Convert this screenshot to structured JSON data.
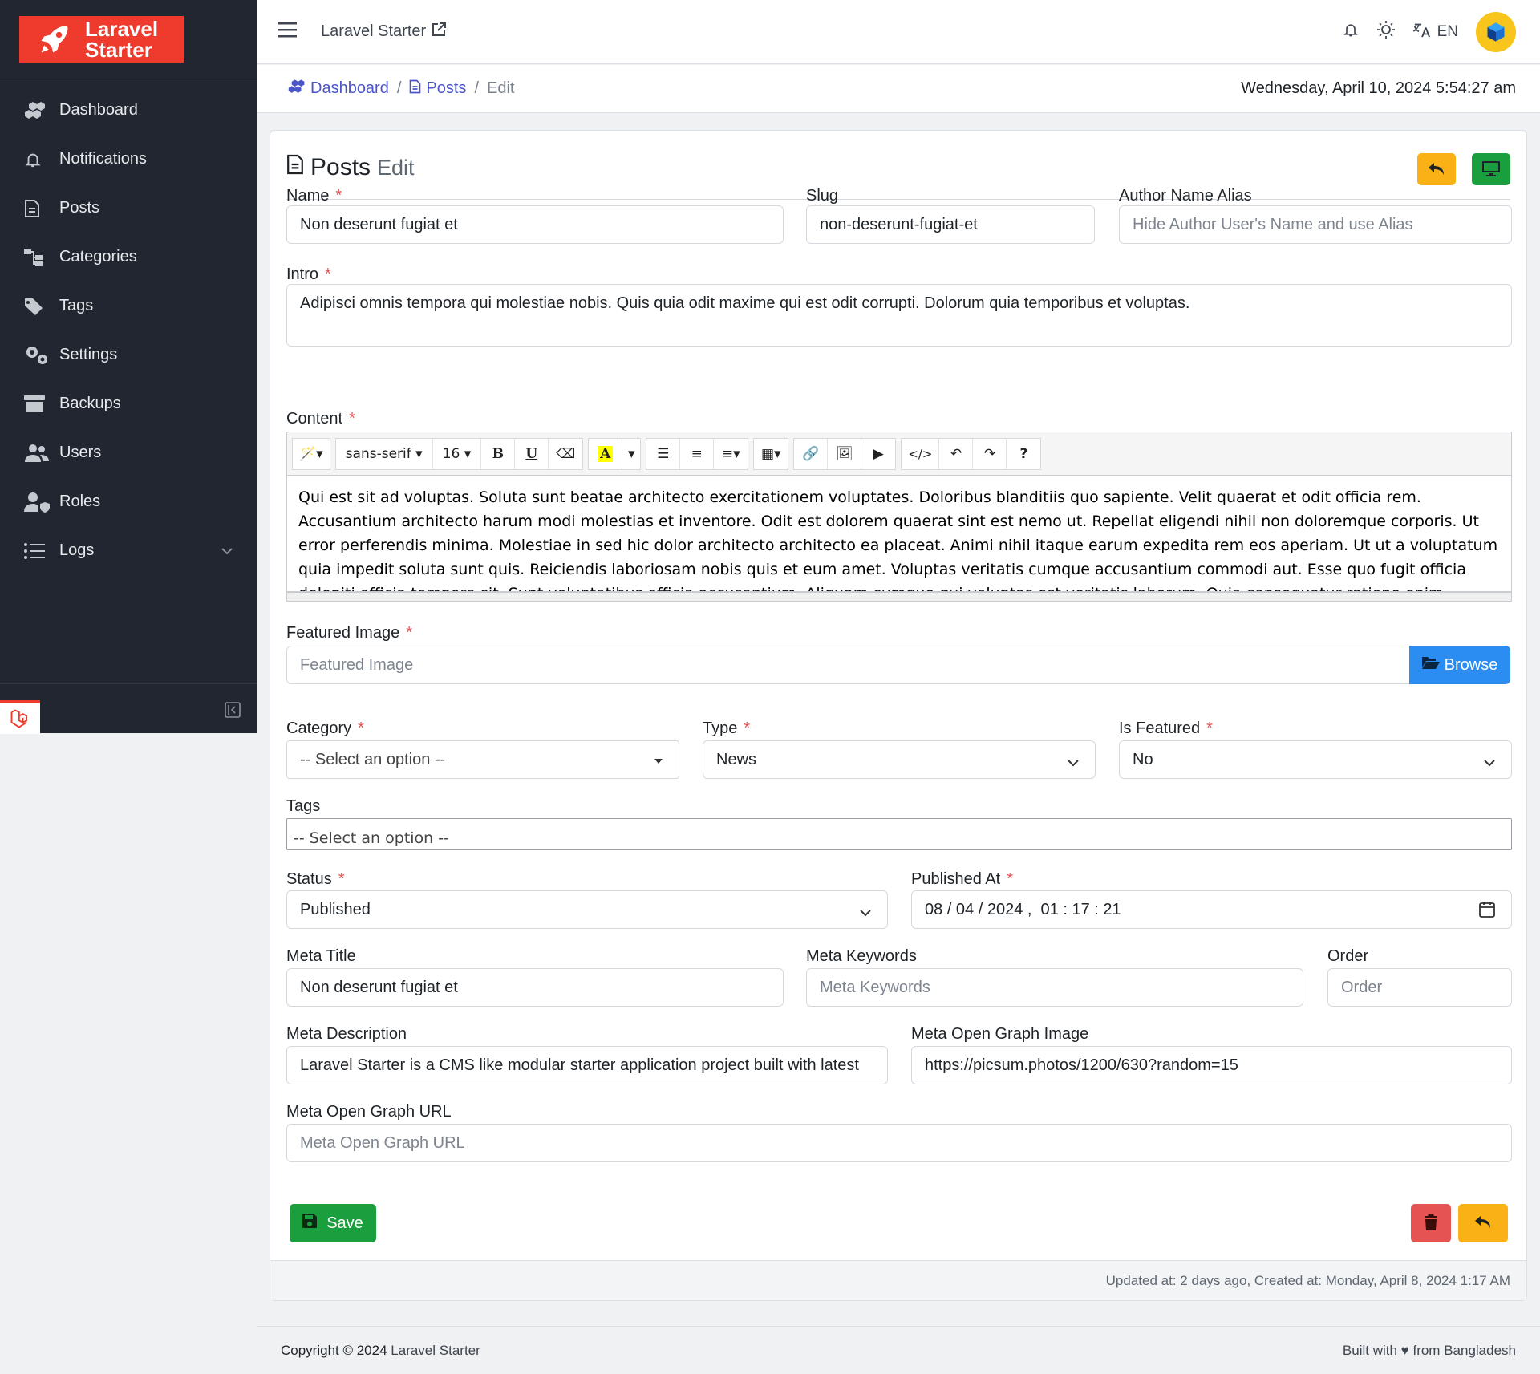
{
  "sidebar": {
    "logo_line1": "Laravel",
    "logo_line2": "Starter",
    "items": [
      {
        "label": "Dashboard"
      },
      {
        "label": "Notifications"
      },
      {
        "label": "Posts"
      },
      {
        "label": "Categories"
      },
      {
        "label": "Tags"
      },
      {
        "label": "Settings"
      },
      {
        "label": "Backups"
      },
      {
        "label": "Users"
      },
      {
        "label": "Roles"
      },
      {
        "label": "Logs"
      }
    ]
  },
  "header": {
    "app_title": "Laravel Starter",
    "language": "EN"
  },
  "breadcrumb": {
    "dashboard": "Dashboard",
    "posts": "Posts",
    "current": "Edit",
    "sep": "/"
  },
  "datetime": "Wednesday, April 10, 2024 5:54:27 am",
  "page": {
    "title": "Posts",
    "subtitle": "Edit"
  },
  "form": {
    "name": {
      "label": "Name",
      "value": "Non deserunt fugiat et"
    },
    "slug": {
      "label": "Slug",
      "value": "non-deserunt-fugiat-et"
    },
    "author_alias": {
      "label": "Author Name Alias",
      "placeholder": "Hide Author User's Name and use Alias"
    },
    "intro": {
      "label": "Intro",
      "value": "Adipisci omnis tempora qui molestiae nobis. Quis quia odit maxime qui est odit corrupti. Dolorum quia temporibus et voluptas."
    },
    "content": {
      "label": "Content",
      "font_name": "sans-serif",
      "font_size": "16",
      "value": "Qui est sit ad voluptas. Soluta sunt beatae architecto exercitationem voluptates. Doloribus blanditiis quo sapiente. Velit quaerat et odit officia rem. Accusantium architecto harum modi molestias et inventore. Odit est dolorem quaerat sint est nemo ut. Repellat eligendi nihil non doloremque corporis. Ut error perferendis minima. Molestiae in sed hic dolor architecto architecto ea placeat. Animi nihil itaque earum expedita rem eos aperiam. Ut ut a voluptatum quia impedit soluta sunt quis. Reiciendis laboriosam nobis quis et eum amet. Voluptas veritatis cumque accusantium commodi aut. Esse quo fugit officia deleniti officia tempora sit. Sunt voluptatibus officia accusantium. Aliquam cumque qui voluptas est veritatis laborum. Quia consequatur ratione enim excepturi in omnis facere."
    },
    "featured_image": {
      "label": "Featured Image",
      "placeholder": "Featured Image",
      "browse": "Browse"
    },
    "category": {
      "label": "Category",
      "value": "-- Select an option --"
    },
    "type": {
      "label": "Type",
      "value": "News"
    },
    "is_featured": {
      "label": "Is Featured",
      "value": "No"
    },
    "tags": {
      "label": "Tags",
      "value": "-- Select an option --"
    },
    "status": {
      "label": "Status",
      "value": "Published"
    },
    "published_at": {
      "label": "Published At",
      "value": "08 / 04 / 2024 ,  01 : 17 : 21"
    },
    "meta_title": {
      "label": "Meta Title",
      "value": "Non deserunt fugiat et"
    },
    "meta_keywords": {
      "label": "Meta Keywords",
      "placeholder": "Meta Keywords"
    },
    "order": {
      "label": "Order",
      "placeholder": "Order"
    },
    "meta_description": {
      "label": "Meta Description",
      "value": "Laravel Starter is a CMS like modular starter application project built with latest"
    },
    "meta_og_image": {
      "label": "Meta Open Graph Image",
      "value": "https://picsum.photos/1200/630?random=15"
    },
    "meta_og_url": {
      "label": "Meta Open Graph URL",
      "placeholder": "Meta Open Graph URL"
    },
    "required_mark": "*"
  },
  "buttons": {
    "save": "Save"
  },
  "card_footer": "Updated at: 2 days ago, Created at: Monday, April 8, 2024 1:17 AM",
  "footer": {
    "copyright": "Copyright © 2024",
    "brand": "Laravel Starter",
    "built": "Built with ♥ from Bangladesh"
  },
  "colors": {
    "sidebar_bg": "#212631",
    "brand_red": "#ef3b2d",
    "link": "#4a55c7",
    "warning": "#f9b115",
    "success": "#1b9e3e",
    "danger": "#e55353",
    "info": "#2b8cf2"
  }
}
